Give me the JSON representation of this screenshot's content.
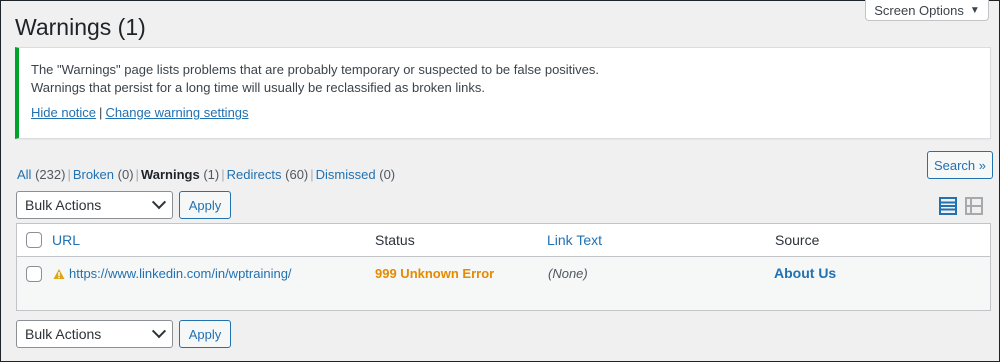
{
  "header": {
    "title": "Warnings (1)",
    "screen_options": "Screen Options"
  },
  "notice": {
    "line1": "The \"Warnings\" page lists problems that are probably temporary or suspected to be false positives.",
    "line2": "Warnings that persist for a long time will usually be reclassified as broken links.",
    "hide_link": "Hide notice",
    "separator": "|",
    "settings_link": "Change warning settings"
  },
  "filters": [
    {
      "label": "All",
      "count": "(232)"
    },
    {
      "label": "Broken",
      "count": "(0)"
    },
    {
      "label": "Warnings",
      "count": "(1)"
    },
    {
      "label": "Redirects",
      "count": "(60)"
    },
    {
      "label": "Dismissed",
      "count": "(0)"
    }
  ],
  "search_button": "Search »",
  "bulk": {
    "select_value": "Bulk Actions",
    "apply": "Apply"
  },
  "table": {
    "columns": {
      "url": "URL",
      "status": "Status",
      "link_text": "Link Text",
      "source": "Source"
    },
    "rows": [
      {
        "url": "https://www.linkedin.com/in/wptraining/",
        "status": "999 Unknown Error",
        "link_text": "(None)",
        "source": "About Us"
      }
    ]
  },
  "colors": {
    "accent": "#2271b1",
    "notice_border": "#00a32a",
    "status_warning": "#e68a00",
    "warning_icon": "#dba617"
  },
  "icons": {
    "view_list": "list-view-icon",
    "view_excerpt": "excerpt-view-icon",
    "warning": "warning-triangle-icon"
  }
}
